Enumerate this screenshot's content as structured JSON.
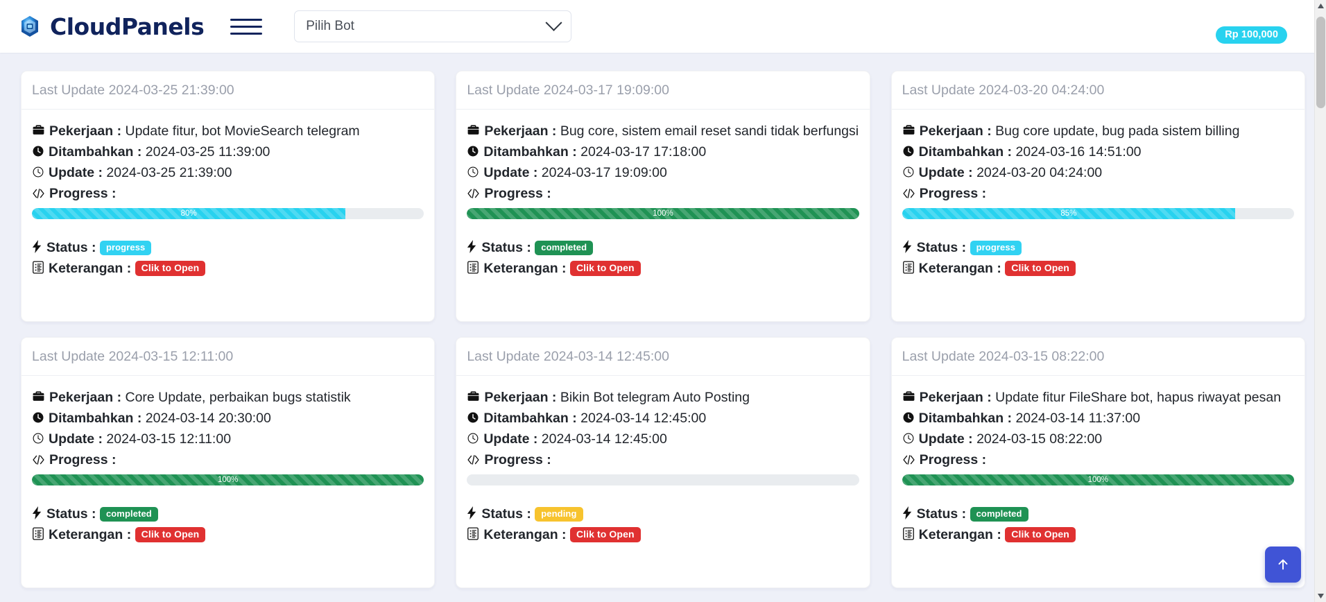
{
  "header": {
    "brand_name": "CloudPanels",
    "logo_icon": "gem-globe-icon",
    "menu_icon": "hamburger-menu-icon",
    "bot_select": {
      "value": "Pilih Bot",
      "placeholder": "Pilih Bot",
      "chevron_icon": "chevron-down-icon"
    },
    "balance": "Rp 100,000",
    "balance_color": "#28d2ef"
  },
  "labels": {
    "last_update_prefix": "Last Update",
    "pekerjaan": "Pekerjaan :",
    "ditambahkan": "Ditambahkan :",
    "update": "Update :",
    "progress": "Progress :",
    "status": "Status :",
    "keterangan": "Keterangan :",
    "open_button": "Clik to Open"
  },
  "icons": {
    "pekerjaan": "briefcase-icon",
    "ditambahkan": "clock-filled-icon",
    "update": "clock-outline-icon",
    "progress": "code-tags-icon",
    "status": "bolt-icon",
    "keterangan": "document-list-icon",
    "scroll_top": "arrow-up-icon"
  },
  "colors": {
    "info": "#28d2ef",
    "success": "#1f9254",
    "warning": "#f7c32e",
    "danger": "#e03131",
    "brand": "#10235c",
    "fab": "#4054d6",
    "page_bg": "#eef0f8"
  },
  "cards": [
    {
      "last_update": "Last Update 2024-03-25 21:39:00",
      "pekerjaan": "Update fitur, bot MovieSearch telegram",
      "ditambahkan": "2024-03-25 11:39:00",
      "update": "2024-03-25 21:39:00",
      "progress_value": 80,
      "progress_text": "80%",
      "progress_variant": "info",
      "status": "progress",
      "status_variant": "progress",
      "keterangan_button": "Clik to Open"
    },
    {
      "last_update": "Last Update 2024-03-17 19:09:00",
      "pekerjaan": "Bug core, sistem email reset sandi tidak berfungsi",
      "ditambahkan": "2024-03-17 17:18:00",
      "update": "2024-03-17 19:09:00",
      "progress_value": 100,
      "progress_text": "100%",
      "progress_variant": "success",
      "status": "completed",
      "status_variant": "completed",
      "keterangan_button": "Clik to Open"
    },
    {
      "last_update": "Last Update 2024-03-20 04:24:00",
      "pekerjaan": "Bug core update, bug pada sistem billing",
      "ditambahkan": "2024-03-16 14:51:00",
      "update": "2024-03-20 04:24:00",
      "progress_value": 85,
      "progress_text": "85%",
      "progress_variant": "info",
      "status": "progress",
      "status_variant": "progress",
      "keterangan_button": "Clik to Open"
    },
    {
      "last_update": "Last Update 2024-03-15 12:11:00",
      "pekerjaan": "Core Update, perbaikan bugs statistik",
      "ditambahkan": "2024-03-14 20:30:00",
      "update": "2024-03-15 12:11:00",
      "progress_value": 100,
      "progress_text": "100%",
      "progress_variant": "success",
      "status": "completed",
      "status_variant": "completed",
      "keterangan_button": "Clik to Open"
    },
    {
      "last_update": "Last Update 2024-03-14 12:45:00",
      "pekerjaan": "Bikin Bot telegram Auto Posting",
      "ditambahkan": "2024-03-14 12:45:00",
      "update": "2024-03-14 12:45:00",
      "progress_value": 0,
      "progress_text": "",
      "progress_variant": "none",
      "status": "pending",
      "status_variant": "pending",
      "keterangan_button": "Clik to Open"
    },
    {
      "last_update": "Last Update 2024-03-15 08:22:00",
      "pekerjaan": "Update fitur FileShare bot, hapus riwayat pesan",
      "ditambahkan": "2024-03-14 11:37:00",
      "update": "2024-03-15 08:22:00",
      "progress_value": 100,
      "progress_text": "100%",
      "progress_variant": "success",
      "status": "completed",
      "status_variant": "completed",
      "keterangan_button": "Clik to Open"
    }
  ]
}
